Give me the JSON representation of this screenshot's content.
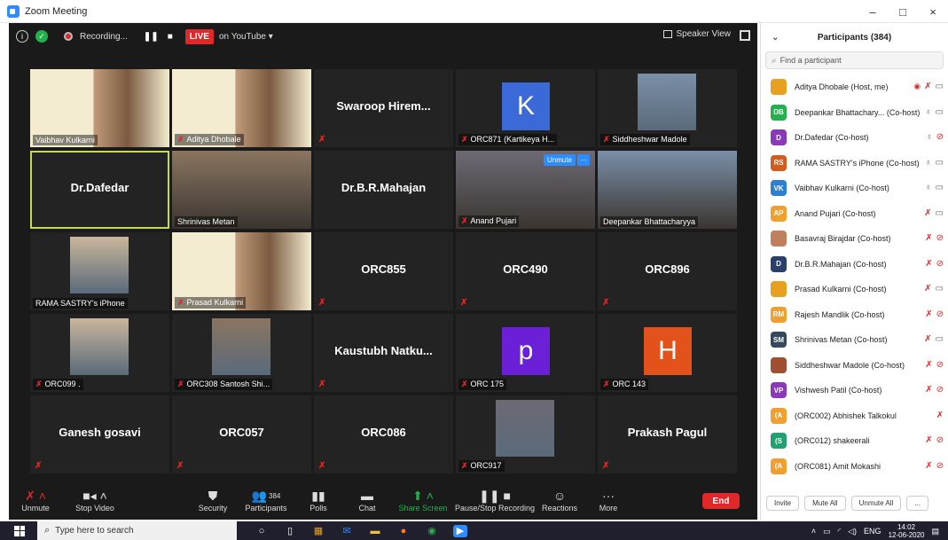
{
  "window": {
    "title": "Zoom Meeting",
    "minimize": "–",
    "maximize": "□",
    "close": "×"
  },
  "topbar": {
    "recording_label": "Recording...",
    "live_badge": "LIVE",
    "youtube_label": "on YouTube",
    "speaker_view_label": "Speaker View"
  },
  "tiles": [
    {
      "label": "Vaibhav Kulkarni",
      "muted": false
    },
    {
      "label": "Aditya Dhobale",
      "muted": true
    },
    {
      "big": "Swaroop Hirem...",
      "muted": true
    },
    {
      "label": "ORC871 (Kartikeya H...",
      "muted": true,
      "avatar": "K",
      "avatar_color": "#3b6ad8"
    },
    {
      "label": "Siddheshwar Madole",
      "muted": true
    },
    {
      "big": "Dr.Dafedar",
      "active": true
    },
    {
      "label": "Shrinivas Metan",
      "muted": false
    },
    {
      "big": "Dr.B.R.Mahajan",
      "muted": false
    },
    {
      "label": "Anand Pujari",
      "muted": true,
      "unmute": "Unmute",
      "more": "···"
    },
    {
      "label": "Deepankar Bhattacharyya",
      "muted": false
    },
    {
      "label": "RAMA SASTRY's iPhone",
      "muted": false
    },
    {
      "label": "Prasad Kulkarni",
      "muted": true
    },
    {
      "big": "ORC855",
      "muted": true
    },
    {
      "big": "ORC490",
      "muted": true
    },
    {
      "big": "ORC896",
      "muted": true
    },
    {
      "label": "ORC099 .",
      "muted": true
    },
    {
      "label": "ORC308 Santosh Shi...",
      "muted": true
    },
    {
      "big": "Kaustubh Natku...",
      "muted": true
    },
    {
      "label": "ORC 175",
      "muted": true,
      "avatar": "p",
      "avatar_color": "#6b1fd6"
    },
    {
      "label": "ORC 143",
      "muted": true,
      "avatar": "H",
      "avatar_color": "#e4521b"
    },
    {
      "big": "Ganesh gosavi",
      "muted": true
    },
    {
      "big": "ORC057",
      "muted": true
    },
    {
      "big": "ORC086",
      "muted": true
    },
    {
      "label": "ORC917",
      "muted": true
    },
    {
      "big": "Prakash Pagul",
      "muted": true
    }
  ],
  "toolbar": {
    "unmute": "Unmute",
    "stop_video": "Stop Video",
    "security": "Security",
    "participants": "Participants",
    "participants_count": "384",
    "polls": "Polls",
    "chat": "Chat",
    "share_screen": "Share Screen",
    "pause_stop_recording": "Pause/Stop Recording",
    "reactions": "Reactions",
    "more": "More",
    "end": "End"
  },
  "panel": {
    "title": "Participants (384)",
    "search_placeholder": "Find a participant",
    "participants": [
      {
        "initials": "",
        "color": "#e8a020",
        "name": "Aditya Dhobale (Host, me)",
        "mic": "off",
        "cam": "on",
        "rec": true
      },
      {
        "initials": "DB",
        "color": "#23b14d",
        "name": "Deepankar Bhattachary... (Co-host)",
        "mic": "on",
        "cam": "on"
      },
      {
        "initials": "D",
        "color": "#8a3ab9",
        "name": "Dr.Dafedar (Co-host)",
        "mic": "on",
        "cam": "off"
      },
      {
        "initials": "RS",
        "color": "#d45a1e",
        "name": "RAMA SASTRY's iPhone (Co-host)",
        "mic": "on",
        "cam": "on"
      },
      {
        "initials": "VK",
        "color": "#2d7fd3",
        "name": "Vaibhav Kulkarni (Co-host)",
        "mic": "on",
        "cam": "on"
      },
      {
        "initials": "AP",
        "color": "#f0a030",
        "name": "Anand Pujari (Co-host)",
        "mic": "off",
        "cam": "on"
      },
      {
        "initials": "",
        "color": "#c08060",
        "name": "Basavraj Birajdar (Co-host)",
        "mic": "off",
        "cam": "off"
      },
      {
        "initials": "D",
        "color": "#2a3f6b",
        "name": "Dr.B.R.Mahajan (Co-host)",
        "mic": "off",
        "cam": "off"
      },
      {
        "initials": "",
        "color": "#e8a020",
        "name": "Prasad Kulkarni (Co-host)",
        "mic": "off",
        "cam": "on"
      },
      {
        "initials": "RM",
        "color": "#f0a030",
        "name": "Rajesh Mandlik (Co-host)",
        "mic": "off",
        "cam": "off"
      },
      {
        "initials": "SM",
        "color": "#34495e",
        "name": "Shrinivas Metan (Co-host)",
        "mic": "off",
        "cam": "on"
      },
      {
        "initials": "",
        "color": "#a05030",
        "name": "Siddheshwar Madole (Co-host)",
        "mic": "off",
        "cam": "off"
      },
      {
        "initials": "VP",
        "color": "#8a3ab9",
        "name": "Vishwesh Patil (Co-host)",
        "mic": "off",
        "cam": "off"
      },
      {
        "initials": "(A",
        "color": "#f0a030",
        "name": "(ORC002) Abhishek Talkokul",
        "mic": "off",
        "cam": ""
      },
      {
        "initials": "(S",
        "color": "#23a070",
        "name": "(ORC012) shakeerali",
        "mic": "off",
        "cam": "off"
      },
      {
        "initials": "(A",
        "color": "#f0a030",
        "name": "(ORC081) Amit Mokashi",
        "mic": "off",
        "cam": "off"
      }
    ],
    "invite": "Invite",
    "mute_all": "Mute All",
    "unmute_all": "Unmute All",
    "more": "..."
  },
  "taskbar": {
    "search_placeholder": "Type here to search",
    "lang": "ENG",
    "time": "14:02",
    "date": "12-06-2020"
  }
}
